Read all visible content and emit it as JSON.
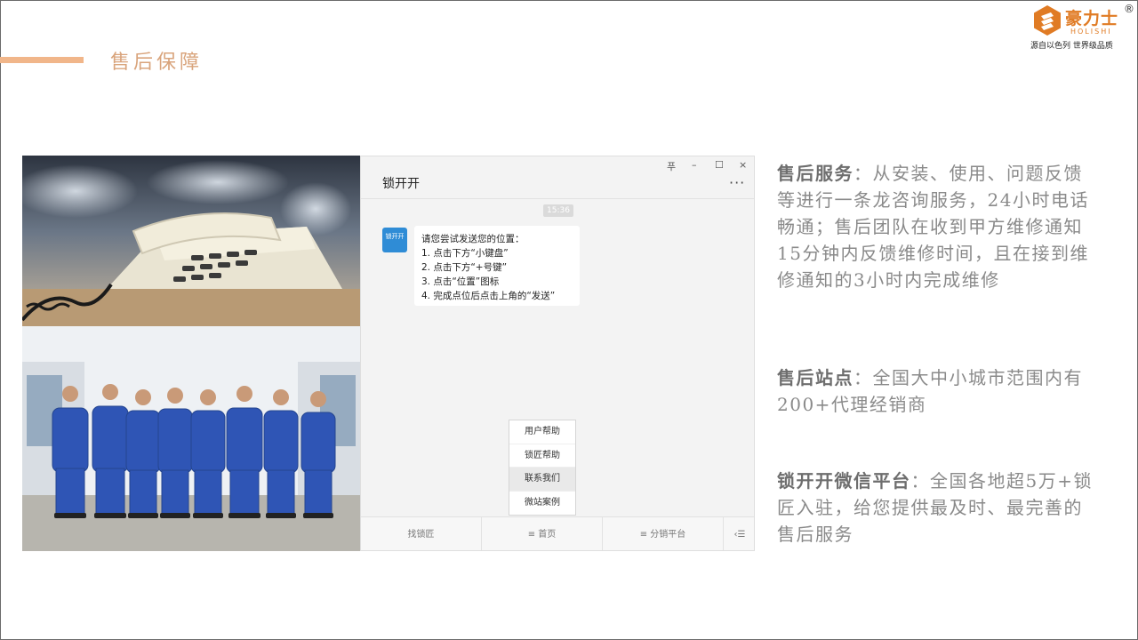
{
  "slide": {
    "title": "售后保障"
  },
  "logo": {
    "brand_cn": "豪力士",
    "registered": "®",
    "brand_en": "HOLISHI",
    "slogan": "源自以色列  世界级品质"
  },
  "chat": {
    "window_title": "锁开开",
    "controls": {
      "pin": "푸",
      "minimize": "–",
      "maximize": "☐",
      "close": "×"
    },
    "more": "···",
    "timestamp": "15:36",
    "avatar_text": "锁开开",
    "message": {
      "line1": "请您尝试发送您的位置：",
      "line2": "1. 点击下方“小键盘”",
      "line3": "2. 点击下方“+号键”",
      "line4": "3. 点击“位置”图标",
      "line5": "4. 完成点位后点击上角的“发送”"
    },
    "popup_menu": [
      "用户帮助",
      "锁匠帮助",
      "联系我们",
      "微站案例"
    ],
    "footer_tabs": [
      "找锁匠",
      "≡ 首页",
      "≡ 分销平台",
      "‹☰"
    ]
  },
  "sections": [
    {
      "heading": "售后服务",
      "body": "：从安装、使用、问题反馈等进行一条龙咨询服务，24小时电话畅通；售后团队在收到甲方维修通知15分钟内反馈维修时间，且在接到维修通知的3小时内完成维修"
    },
    {
      "heading": "售后站点",
      "body": "：全国大中小城市范围内有200+代理经销商"
    },
    {
      "heading": "锁开开微信平台",
      "body": "：全国各地超5万+锁匠入驻，给您提供最及时、最完善的售后服务"
    }
  ],
  "colors": {
    "accent_bar": "#f1b68a",
    "title": "#d9a47c",
    "logo": "#e07b24",
    "uniform": "#2f55b5"
  }
}
